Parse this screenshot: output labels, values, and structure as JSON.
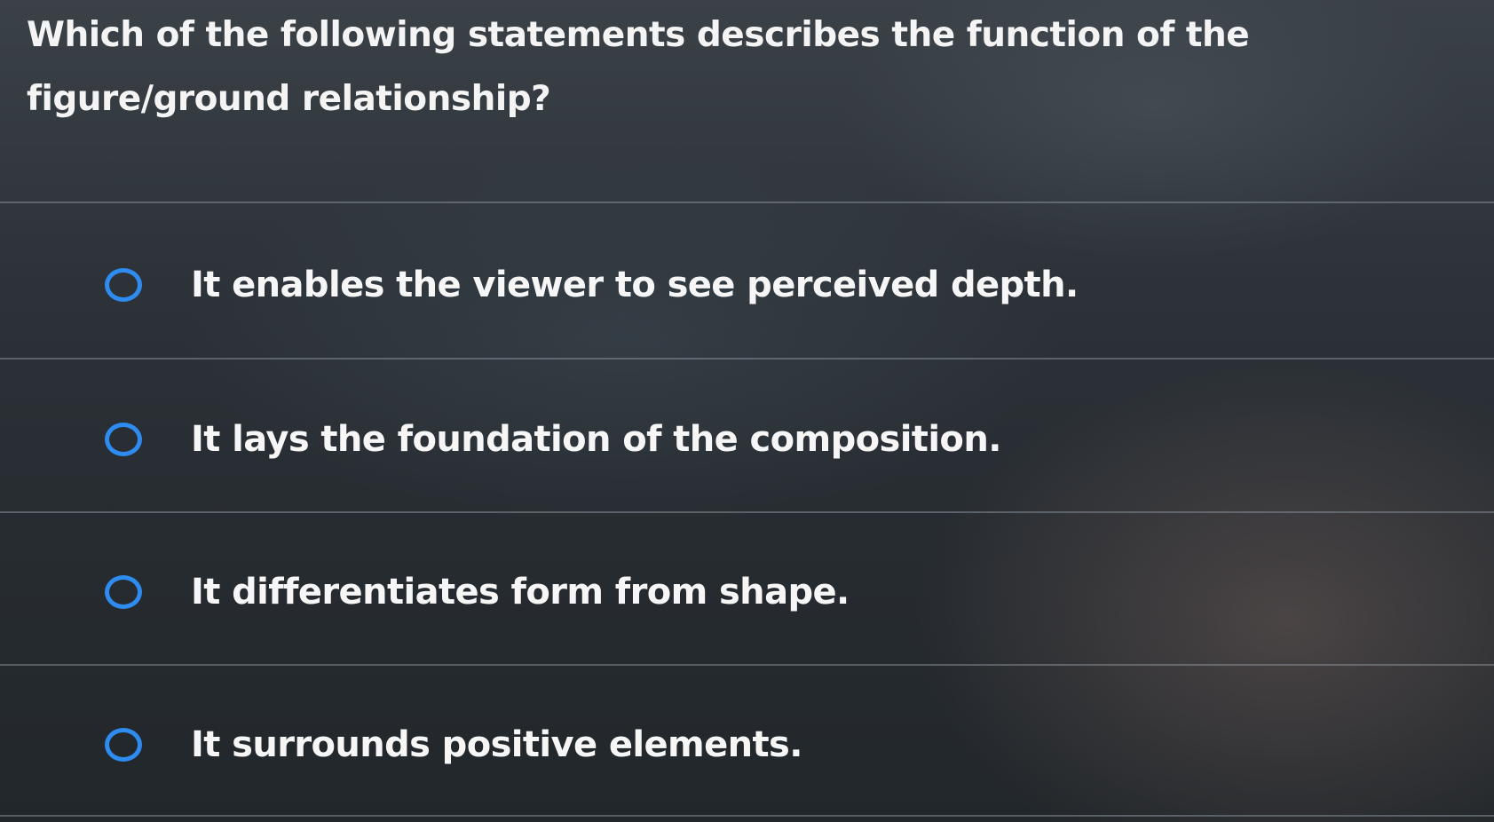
{
  "question": {
    "text": "Which of the following statements describes the function of the figure/ground relationship?"
  },
  "options": [
    {
      "label": "It enables the viewer to see perceived depth."
    },
    {
      "label": "It lays the foundation of the composition."
    },
    {
      "label": "It differentiates form from shape."
    },
    {
      "label": "It surrounds positive elements."
    }
  ],
  "colors": {
    "radio_accent": "#2e8cf0",
    "text": "#f6f6f6",
    "background": "#2c3238"
  }
}
